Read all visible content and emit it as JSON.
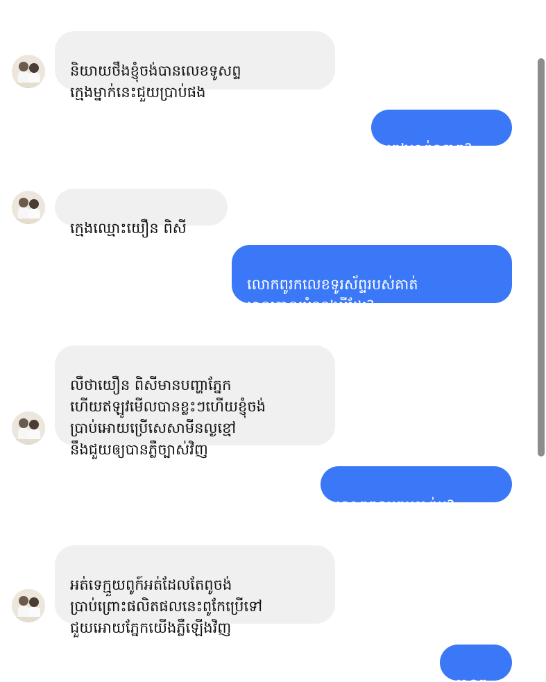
{
  "messages": [
    {
      "side": "incoming",
      "text": "និយាយថឹងខ្ញុំចង់បានលេខទូសព្ទ\nក្មេងម្នាក់នេះជួយប្រាប់ផង"
    },
    {
      "side": "outgoing",
      "text": "ក្មេងម្នាក់ណាពូ?"
    },
    {
      "side": "incoming",
      "text": "ក្មេងឈ្មោះយឿន ពិសី"
    },
    {
      "side": "outgoing",
      "text": "លោកពូរកលេខទូរស័ព្ទរបស់គាត់\nមានគោលបំណងអីដែរ?"
    },
    {
      "side": "incoming",
      "text": "លឺថាយឿន ពិសីមានបញ្ហាភ្នែក\nហើយឥឡូវមើលបានខ្លះៗហើយខ្ញុំចង់\nប្រាប់អោយប្រើសេសាមីនល្ងខ្មៅ\nនឹងជួយឲ្យបានភ្លឺច្បាស់វិញ"
    },
    {
      "side": "outgoing",
      "text": "លោកពូឧបត្ថម្ភគាត់ឬ?"
    },
    {
      "side": "incoming",
      "text": "អត់ទេក្មួយពូក៍អត់ដែលតែពូចង់\nប្រាប់ព្រោះផលិតផលនេះពូកែប្រើទៅ\nជួយអោយភ្នែកយើងភ្លឺឡើងវិញ"
    },
    {
      "side": "outgoing",
      "text": "បាទពូ"
    }
  ],
  "colors": {
    "outgoing_bubble": "#3b78f7",
    "incoming_bubble": "#f0f0f0"
  },
  "icons": {
    "avatar": "user-photo-avatar"
  }
}
